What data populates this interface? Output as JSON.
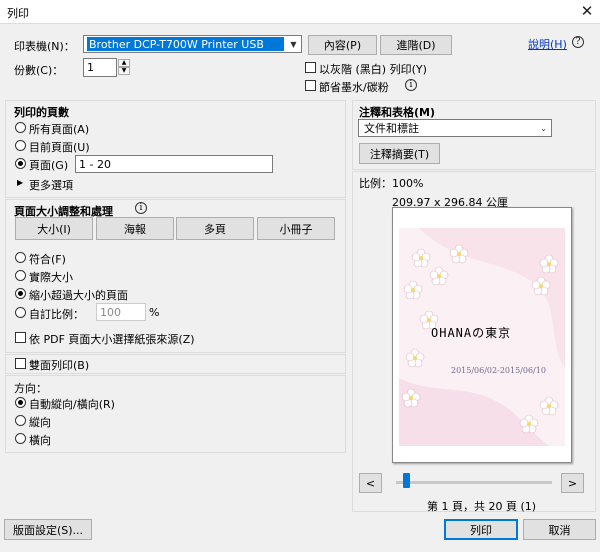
{
  "window": {
    "title": "列印",
    "close": "✕"
  },
  "printer": {
    "label": "印表機(N)：",
    "selected": "Brother DCP-T700W Printer USB",
    "properties_btn": "內容(P)",
    "advanced_btn": "進階(D)",
    "help_link": "說明(H)",
    "help_icon": "?"
  },
  "copies": {
    "label": "份數(C)：",
    "value": "1"
  },
  "options": {
    "grayscale": "以灰階 (黑白) 列印(Y)",
    "save_ink": "節省墨水/碳粉",
    "info": "i"
  },
  "pages": {
    "heading": "列印的頁數",
    "all": "所有頁面(A)",
    "current": "目前頁面(U)",
    "pages_label": "頁面(G)",
    "pages_value": "1 - 20",
    "more": "更多選項",
    "more_arrow": "▶"
  },
  "sizing": {
    "heading": "頁面大小調整和處理",
    "tabs": [
      "大小(I)",
      "海報",
      "多頁",
      "小冊子"
    ],
    "fit": "符合(F)",
    "actual": "實際大小",
    "shrink": "縮小超過大小的頁面",
    "custom": "自訂比例：",
    "custom_value": "100",
    "percent": "%",
    "pdf_source": "依 PDF 頁面大小選擇紙張來源(Z)"
  },
  "duplex": {
    "label": "雙面列印(B)"
  },
  "orientation": {
    "heading": "方向：",
    "auto": "自動縱向/橫向(R)",
    "portrait": "縱向",
    "landscape": "橫向"
  },
  "comments": {
    "heading": "注釋和表格(M)",
    "selected": "文件和標註",
    "summary_btn": "注釋摘要(T)"
  },
  "preview": {
    "scale": "比例：100%",
    "dimensions": "209.97 x 296.84 公厘",
    "sheet_title": "OHANAの東京",
    "sheet_dates": "2015/06/02-2015/06/10",
    "prev": "<",
    "next": ">",
    "page_status": "第 1 頁，共 20 頁 (1)",
    "slider_fraction": 0.05
  },
  "footer": {
    "page_setup": "版面設定(S)...",
    "print": "列印",
    "cancel": "取消"
  },
  "colors": {
    "accent": "#0078d7",
    "flower": "#f3c9d9"
  }
}
